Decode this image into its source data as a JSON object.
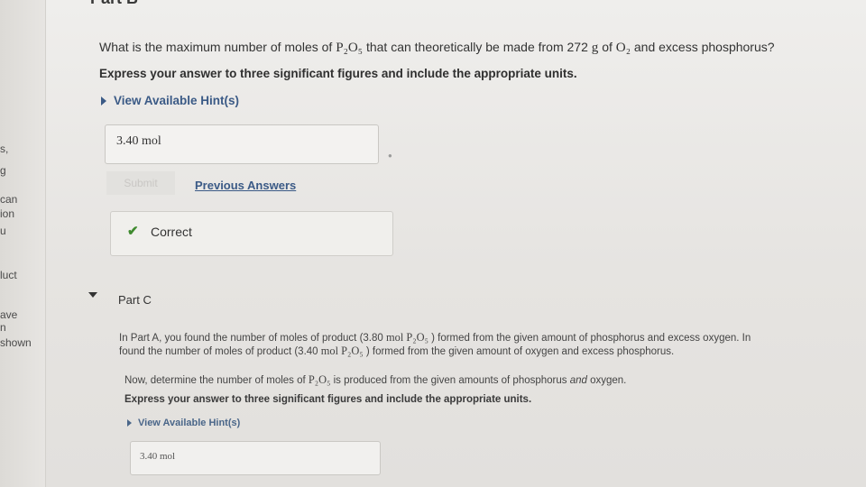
{
  "part_b": {
    "heading": "Part B",
    "question_pre": "What is the maximum number of moles of ",
    "question_formula1": "P₂O₅",
    "question_mid": " that can theoretically be made from 272 ",
    "question_unit": "g",
    "question_of": " of ",
    "question_formula2": "O₂",
    "question_post": " and excess phosphorus?",
    "instruction": "Express your answer to three significant figures and include the appropriate units.",
    "hint_label": "View Available Hint(s)",
    "answer_value": "3.40 mol",
    "submit_label": "Submit",
    "previous_answers_label": "Previous Answers",
    "feedback": "Correct"
  },
  "part_c": {
    "title": "Part C",
    "intro_line1_pre": "In Part A, you found the number of moles of product (3.80 ",
    "intro_line1_formula": "mol P₂O₅",
    "intro_line1_post": " ) formed from the given amount of phosphorus and excess oxygen. In",
    "intro_line2_pre": "found the number of moles of product (3.40 ",
    "intro_line2_formula": "mol P₂O₅",
    "intro_line2_post": " ) formed from the given amount of oxygen and excess phosphorus.",
    "question_pre": "Now, determine the number of moles of ",
    "question_formula": "P₂O₅",
    "question_mid": " is produced from the given amounts of phosphorus ",
    "question_and": "and",
    "question_post": " oxygen.",
    "instruction": "Express your answer to three significant figures and include the appropriate units.",
    "hint_label": "View Available Hint(s)",
    "answer_value": "3.40 mol"
  },
  "gutter": [
    "s,",
    "g",
    "can",
    "ion",
    "u",
    "luct",
    "ave",
    "n",
    "shown"
  ],
  "colors": {
    "link": "#3b5a86",
    "correct": "#3f8a2f"
  }
}
